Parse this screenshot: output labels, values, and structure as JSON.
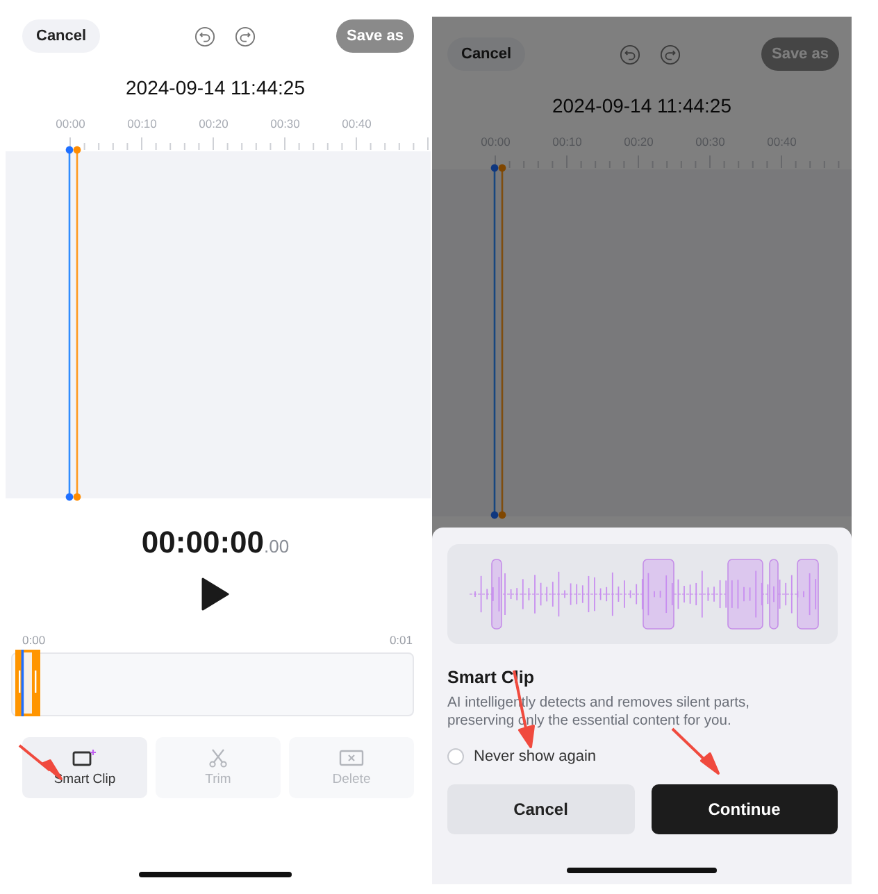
{
  "screens": [
    {
      "cancel": "Cancel",
      "save": "Save as",
      "timestamp": "2024-09-14 11:44:25",
      "ruler": [
        "00:00",
        "00:10",
        "00:20",
        "00:30",
        "00:40"
      ],
      "timer": "00:00:00",
      "timer_fraction": ".00",
      "clip_start": "0:00",
      "clip_end": "0:01",
      "tools": [
        {
          "label": "Smart Clip",
          "kind": "smart-clip",
          "disabled": false
        },
        {
          "label": "Trim",
          "kind": "trim",
          "disabled": true
        },
        {
          "label": "Delete",
          "kind": "delete",
          "disabled": true
        }
      ]
    },
    {
      "cancel": "Cancel",
      "save": "Save as",
      "timestamp": "2024-09-14 11:44:25",
      "ruler": [
        "00:00",
        "00:10",
        "00:20",
        "00:30",
        "00:40"
      ],
      "dimmed": true,
      "sheet": {
        "title": "Smart Clip",
        "description": "AI intelligently detects and removes silent parts, preserving only the essential content for you.",
        "never_show": {
          "label": "Never show again",
          "checked": false
        },
        "buttons": [
          {
            "label": "Cancel",
            "kind": "secondary"
          },
          {
            "label": "Continue",
            "kind": "primary"
          }
        ]
      }
    }
  ]
}
